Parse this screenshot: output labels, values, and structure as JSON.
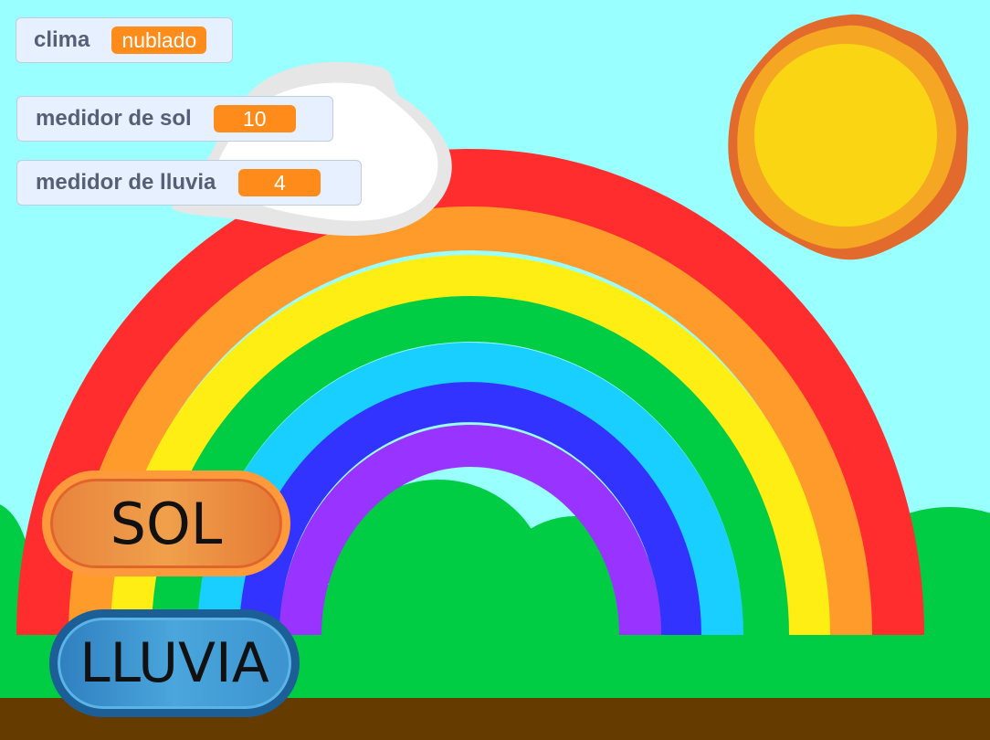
{
  "monitors": {
    "clima": {
      "label": "clima",
      "value": "nublado"
    },
    "sol": {
      "label": "medidor de sol",
      "value": "10"
    },
    "lluvia": {
      "label": "medidor de lluvia",
      "value": "4"
    }
  },
  "buttons": {
    "sol_label": "SOL",
    "lluvia_label": "LLUVIA"
  },
  "colors": {
    "sky": "#99ffff",
    "grass": "#00cc44",
    "ground": "#663b00",
    "rainbow": [
      "#ff2d2d",
      "#ff9b2b",
      "#ffee14",
      "#00cc44",
      "#19cfff",
      "#3333ff",
      "#9933ff"
    ],
    "sun_core": "#fad514",
    "monitor_value_bg": "#ff8c1a"
  },
  "icons": {
    "sun": "sun-icon",
    "cloud": "cloud-icon"
  }
}
